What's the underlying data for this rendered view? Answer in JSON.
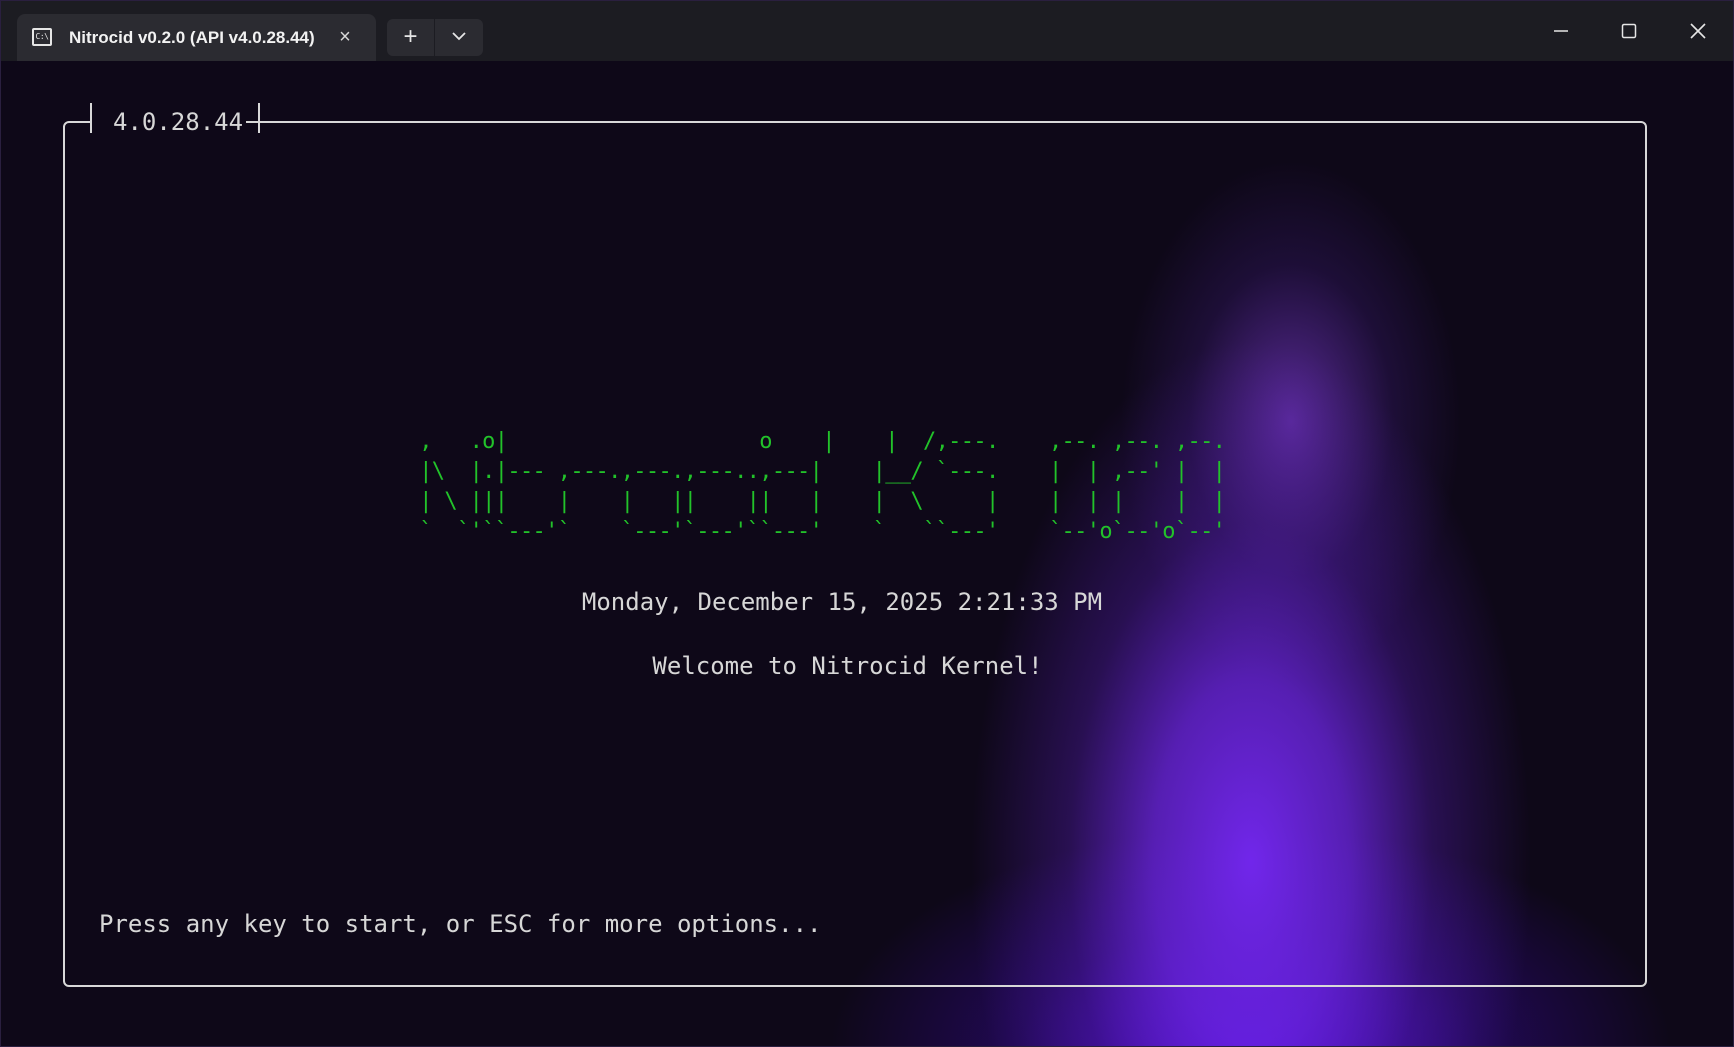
{
  "window": {
    "tab_icon_text": "C:\\",
    "tab_title": "Nitrocid v0.2.0 (API v4.0.28.44)",
    "tab_close_glyph": "×",
    "new_tab_glyph": "+",
    "icons": {
      "tab": "terminal-icon",
      "close_tab": "close-icon",
      "new_tab": "plus-icon",
      "dropdown": "chevron-down-icon",
      "minimize": "minimize-icon",
      "maximize": "maximize-icon",
      "close_window": "close-icon"
    }
  },
  "terminal": {
    "version_label": "4.0.28.44",
    "banner_ascii": "  ,   .o|                    o    |    |  /,---.    ,--. ,--. ,--.\n  |\\  |.|--- ,---.,---.,---..,---|    |__/ `---.    |  | ,--' |  |\n  | \\ |||    |    |   ||    ||   |    |  \\     |    |  | |    |  |\n  `  `'``---'`    `---'`---'``---'    `   ``---'    `--'o`--'o`--'",
    "datetime": "Monday, December 15, 2025 2:21:33 PM",
    "welcome": "Welcome to Nitrocid Kernel!",
    "prompt": "Press any key to start, or ESC for more options..."
  },
  "colors": {
    "background": "#0e0818",
    "titlebar": "#1c1c22",
    "tab": "#2b2b31",
    "banner_green": "#22c22a",
    "text": "#d7d7d7",
    "glow_purple": "#7628f5"
  }
}
